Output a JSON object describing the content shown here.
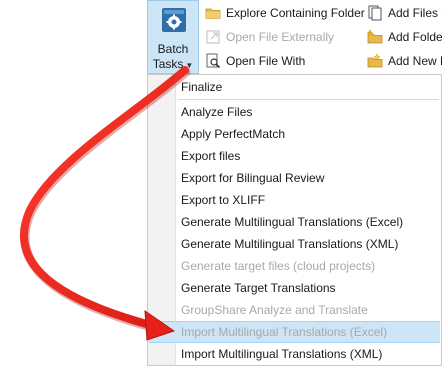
{
  "ribbon": {
    "batch_tasks_line1": "Batch",
    "batch_tasks_line2": "Tasks",
    "explore_label": "Explore Containing Folder",
    "open_external_label": "Open File Externally",
    "open_with_label": "Open File With",
    "add_files_label": "Add Files",
    "add_folder_label": "Add Folde",
    "add_new_label": "Add New F"
  },
  "menu": {
    "items": [
      {
        "label": "Finalize",
        "enabled": true
      },
      {
        "label": "Analyze Files",
        "enabled": true
      },
      {
        "label": "Apply PerfectMatch",
        "enabled": true
      },
      {
        "label": "Export files",
        "enabled": true
      },
      {
        "label": "Export for Bilingual Review",
        "enabled": true
      },
      {
        "label": "Export to XLIFF",
        "enabled": true
      },
      {
        "label": "Generate Multilingual Translations (Excel)",
        "enabled": true
      },
      {
        "label": "Generate Multilingual Translations (XML)",
        "enabled": true
      },
      {
        "label": "Generate target files (cloud projects)",
        "enabled": false
      },
      {
        "label": "Generate Target Translations",
        "enabled": true
      },
      {
        "label": "GroupShare Analyze and Translate",
        "enabled": false
      },
      {
        "label": "Import Multilingual Translations (Excel)",
        "enabled": false,
        "highlighted": true
      },
      {
        "label": "Import Multilingual Translations (XML)",
        "enabled": true
      }
    ]
  },
  "colors": {
    "highlight": "#cde6f7",
    "arrow": "#e8201a",
    "disabled_text": "#a8a8a8"
  }
}
